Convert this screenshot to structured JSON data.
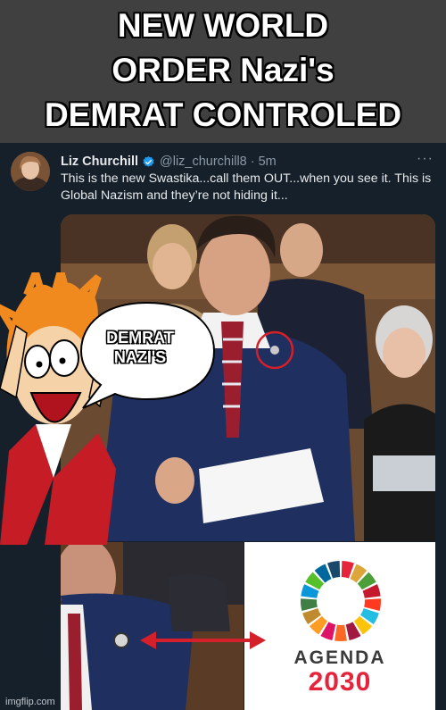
{
  "caption": {
    "text": "NEW WORLD\nORDER Nazi's\nDEMRAT CONTROLED"
  },
  "tweet": {
    "user_name": "Liz Churchill",
    "handle": "@liz_churchill8",
    "separator": "·",
    "time": "5m",
    "more_icon": "more-icon",
    "verified_icon": "verified-badge-icon",
    "body": "This is the new Swastika...call them OUT...when you see it. This is Global Nazism and they’re not hiding it..."
  },
  "speech_bubble": {
    "text": "DEMRAT\nNAZI'S"
  },
  "agenda": {
    "label": "AGENDA",
    "year": "2030"
  },
  "watermark": "imgflip.com",
  "colors": {
    "background": "#15202b",
    "caption_band": "#404040",
    "verified_blue": "#1d9bf0",
    "agenda_red": "#e5243b",
    "annotation_red": "#d4202a"
  }
}
